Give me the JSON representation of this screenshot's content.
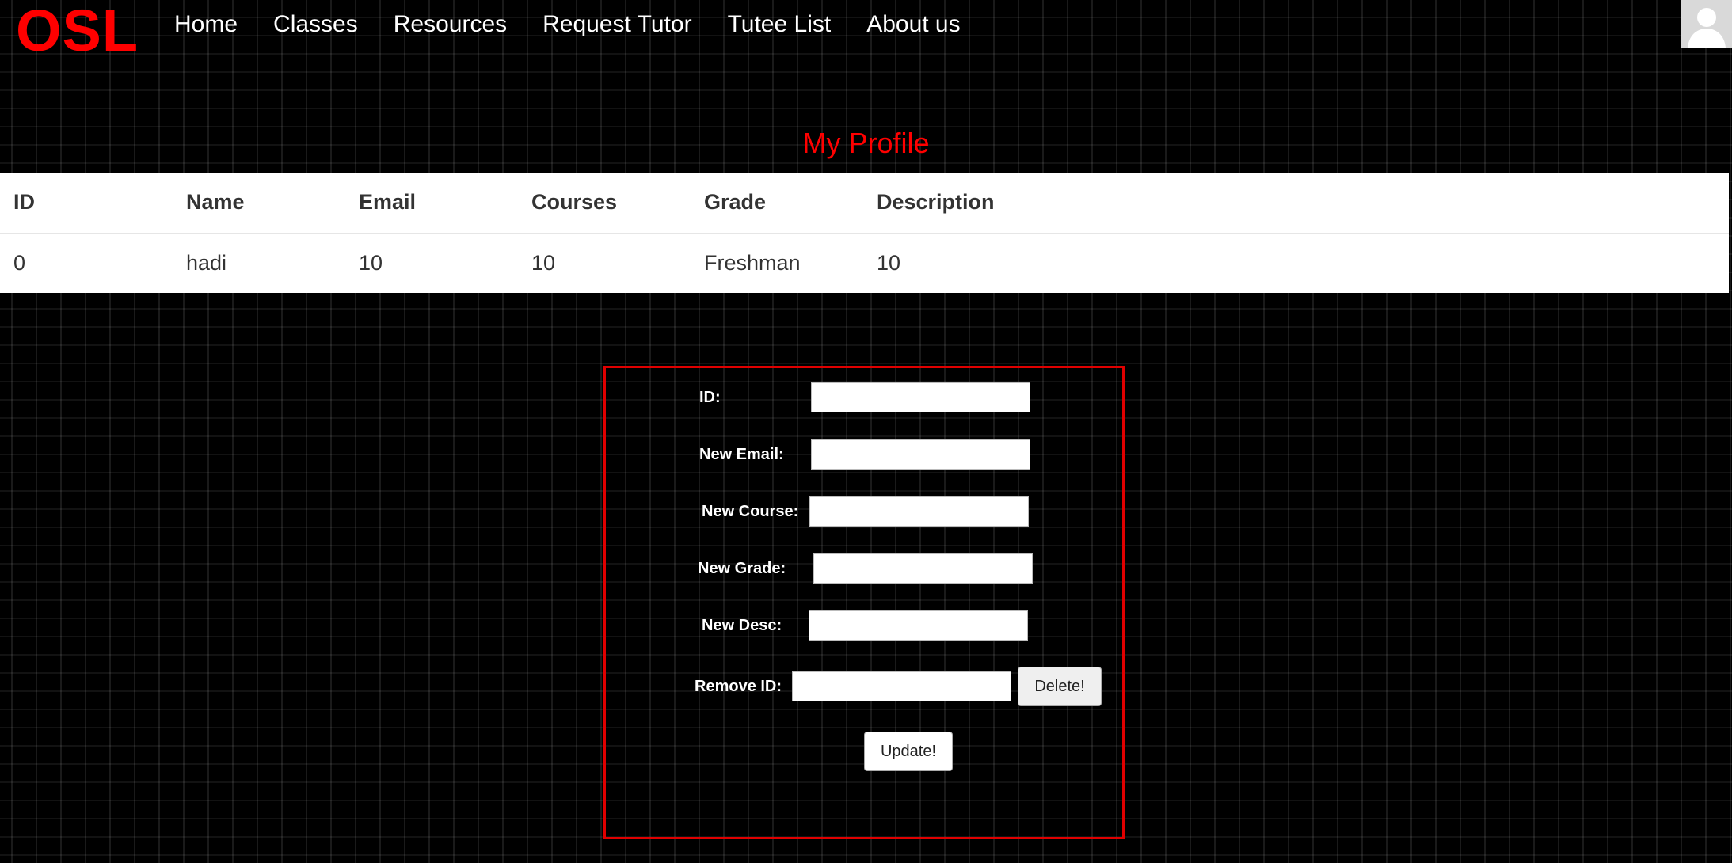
{
  "header": {
    "logo": "OSL",
    "nav": [
      "Home",
      "Classes",
      "Resources",
      "Request Tutor",
      "Tutee List",
      "About us"
    ]
  },
  "page_title": "My Profile",
  "table": {
    "headers": [
      "ID",
      "Name",
      "Email",
      "Courses",
      "Grade",
      "Description"
    ],
    "rows": [
      [
        "0",
        "hadi",
        "10",
        "10",
        "Freshman",
        "10"
      ]
    ]
  },
  "form": {
    "id_label": "ID:",
    "email_label": "New Email:",
    "course_label": "New Course:",
    "grade_label": "New Grade:",
    "desc_label": "New Desc:",
    "remove_label": "Remove ID:",
    "delete_button": "Delete!",
    "update_button": "Update!",
    "id_value": "",
    "email_value": "",
    "course_value": "",
    "grade_value": "",
    "desc_value": "",
    "remove_value": ""
  },
  "colors": {
    "accent": "#ff0000",
    "background": "#000000"
  },
  "icons": {
    "avatar": "user-avatar-icon"
  }
}
